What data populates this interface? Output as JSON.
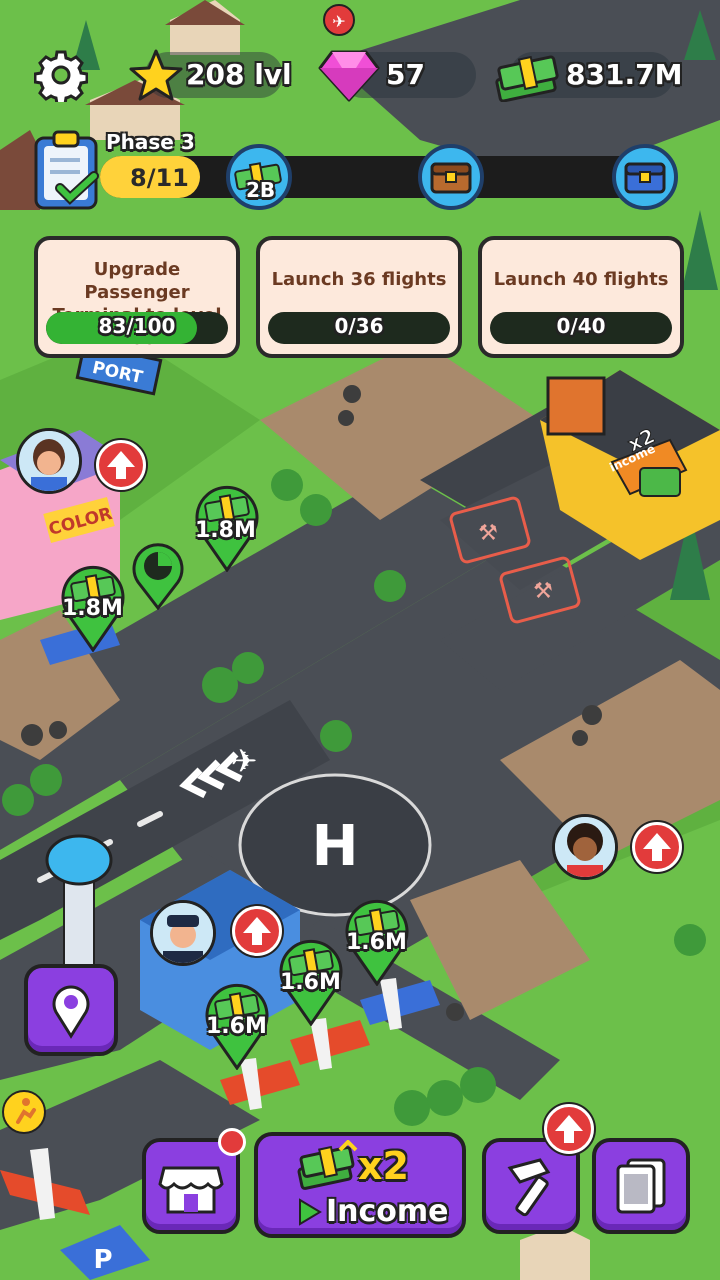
{
  "top_bar": {
    "level": "208 lvl",
    "gems": "57",
    "cash": "831.7M"
  },
  "phase": {
    "title": "Phase 3",
    "progress": "8/11",
    "progress_fraction": 0.727,
    "rewards": [
      {
        "icon": "cash-stack-icon",
        "label": "2B"
      },
      {
        "icon": "wooden-chest-icon",
        "label": ""
      },
      {
        "icon": "blue-chest-icon",
        "label": ""
      }
    ]
  },
  "tasks": [
    {
      "title_line1": "Upgrade Passenger",
      "title_line2": "Terminal to level 100",
      "progress": "83/100",
      "fraction": 0.83
    },
    {
      "title_line1": "Launch 36 flights",
      "title_line2": "",
      "progress": "0/36",
      "fraction": 0
    },
    {
      "title_line1": "Launch 40 flights",
      "title_line2": "",
      "progress": "0/40",
      "fraction": 0
    }
  ],
  "map": {
    "income_pins": [
      "1.8M",
      "1.8M",
      "1.6M",
      "1.6M",
      "1.6M"
    ],
    "shop_sign": "COLOR",
    "airport_sign": "PORT",
    "boost_badge": "x2",
    "boost_badge_sub": "income"
  },
  "bottom_bar": {
    "income_multiplier": "x2",
    "income_label": "Income"
  },
  "colors": {
    "grass": "#6cc04a",
    "road": "#4a4e55",
    "accent_purple": "#8b3fe0",
    "pin_green": "#3fc23f",
    "alert_red": "#e23b3b"
  }
}
